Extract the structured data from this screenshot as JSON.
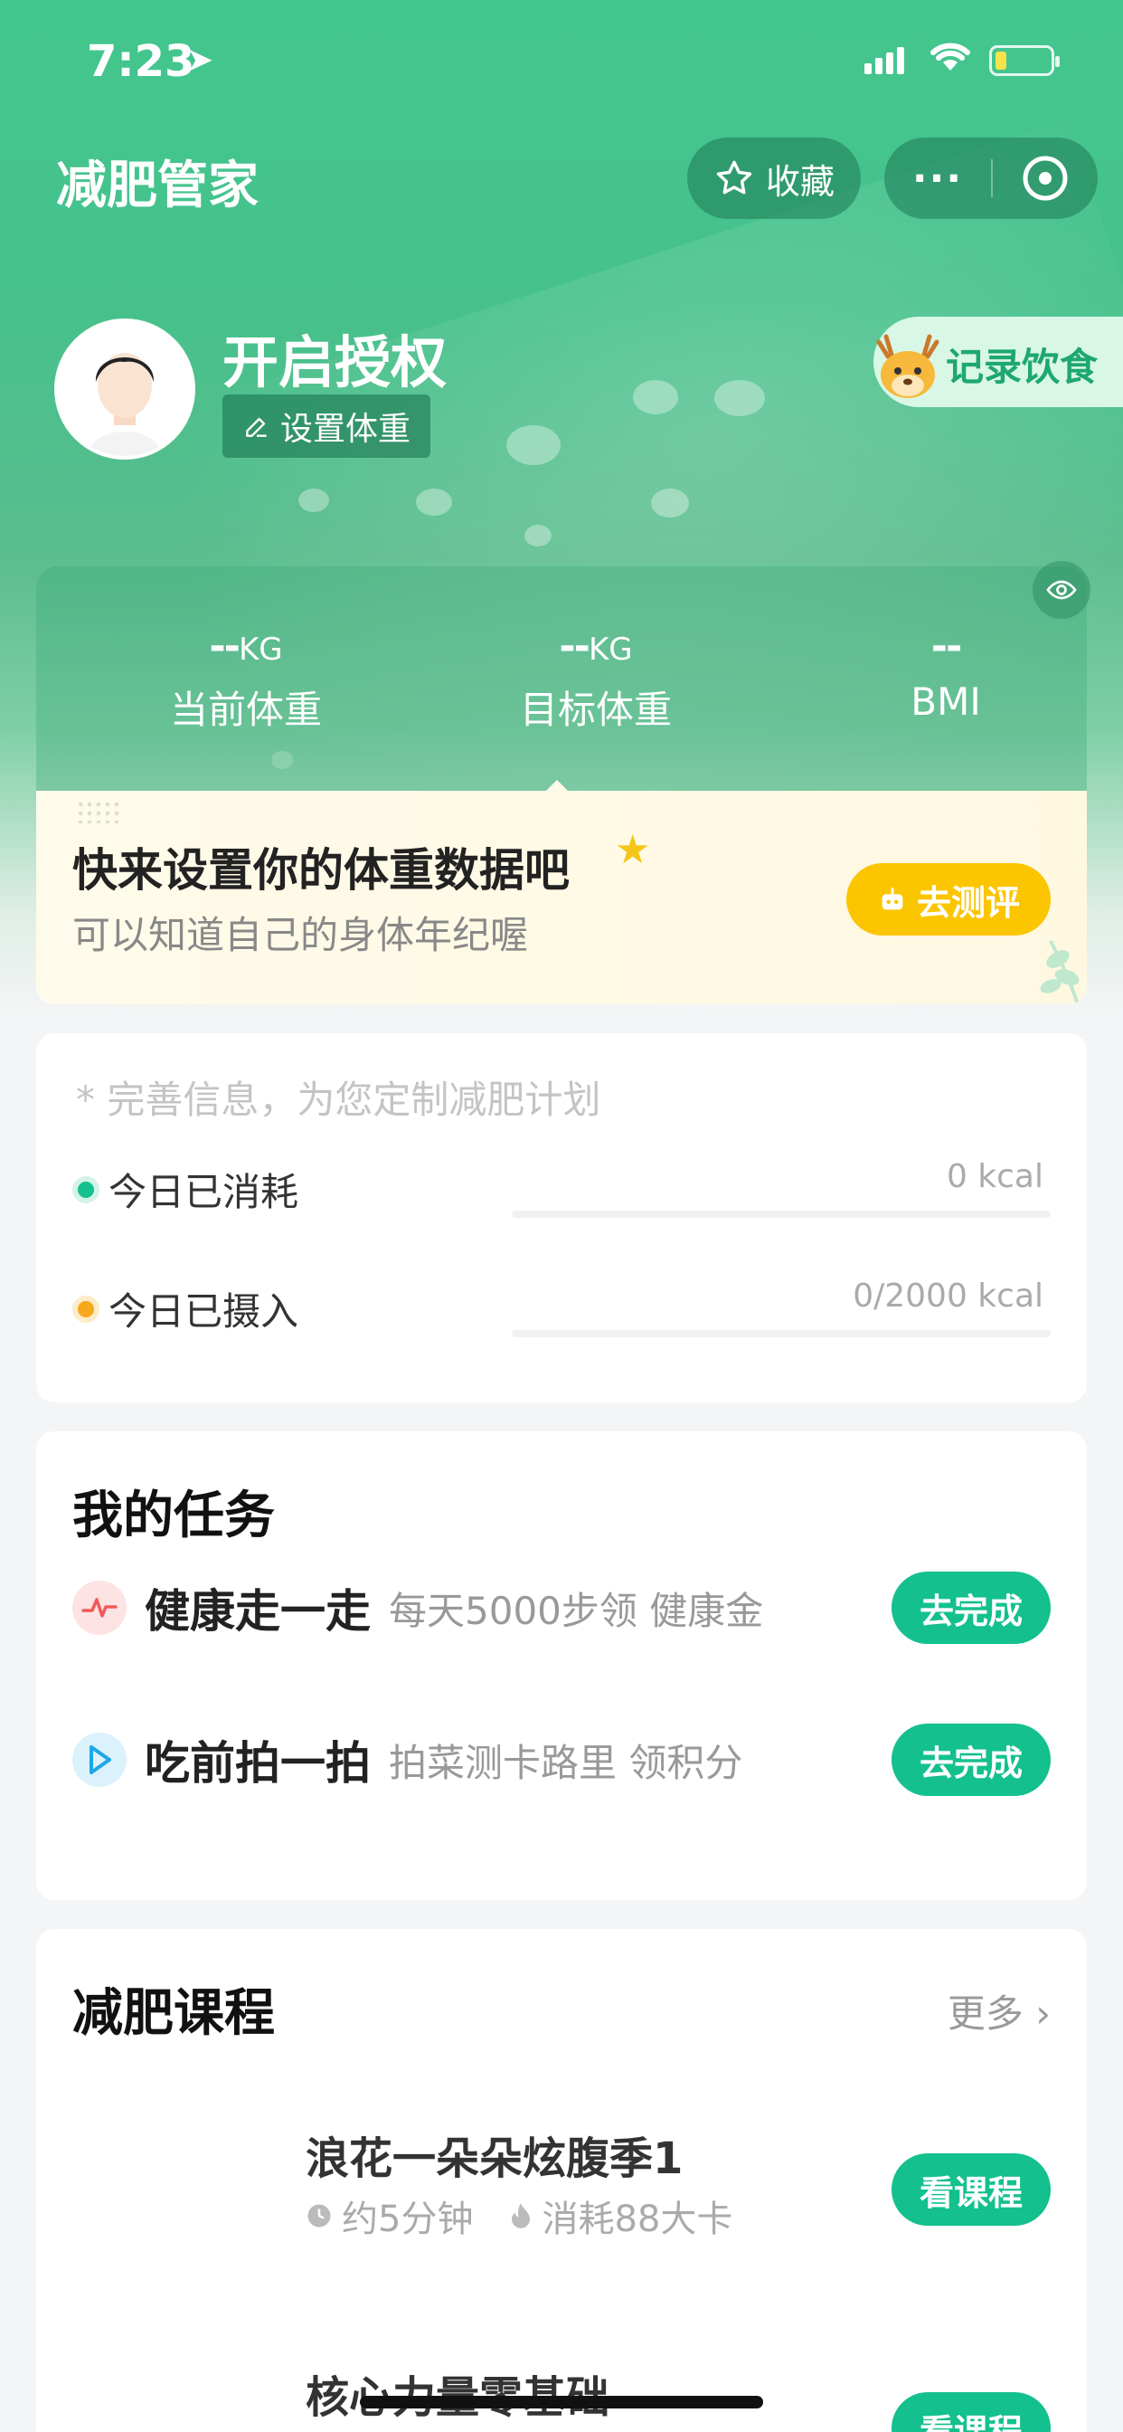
{
  "status_bar": {
    "time": "7:23"
  },
  "header": {
    "title": "减肥管家",
    "favorite_label": "收藏",
    "more_label": "···"
  },
  "profile": {
    "name": "开启授权",
    "set_weight_label": "设置体重",
    "record_diet_label": "记录饮食"
  },
  "stats": [
    {
      "value": "--",
      "unit": "KG",
      "label": "当前体重"
    },
    {
      "value": "--",
      "unit": "KG",
      "label": "目标体重"
    },
    {
      "value": "--",
      "unit": "",
      "label": "BMI"
    }
  ],
  "prompt": {
    "title": "快来设置你的体重数据吧",
    "subtitle": "可以知道自己的身体年纪喔",
    "button": "去测评"
  },
  "energy": {
    "hint": "* 完善信息，为您定制减肥计划",
    "rows": [
      {
        "label": "今日已消耗",
        "value": "0 kcal",
        "dot_color": "#13c08e",
        "progress": 0
      },
      {
        "label": "今日已摄入",
        "value": "0/2000 kcal",
        "dot_color": "#f7a81b",
        "progress": 0
      }
    ]
  },
  "tasks": {
    "title": "我的任务",
    "items": [
      {
        "name": "健康走一走",
        "desc": "每天5000步领 健康金",
        "button": "去完成",
        "icon": "heartbeat-icon"
      },
      {
        "name": "吃前拍一拍",
        "desc": "拍菜测卡路里 领积分",
        "button": "去完成",
        "icon": "play-icon"
      }
    ]
  },
  "courses": {
    "title": "减肥课程",
    "more_label": "更多",
    "items": [
      {
        "title": "浪花一朵朵炫腹季1",
        "duration": "约5分钟",
        "calories": "消耗88大卡",
        "button": "看课程"
      },
      {
        "title": "核心力量零基础",
        "duration": "",
        "calories": "",
        "button": "看课程"
      }
    ]
  },
  "colors": {
    "primary": "#13c08e",
    "header": "#43c68f",
    "accent_yellow": "#fbc500"
  }
}
